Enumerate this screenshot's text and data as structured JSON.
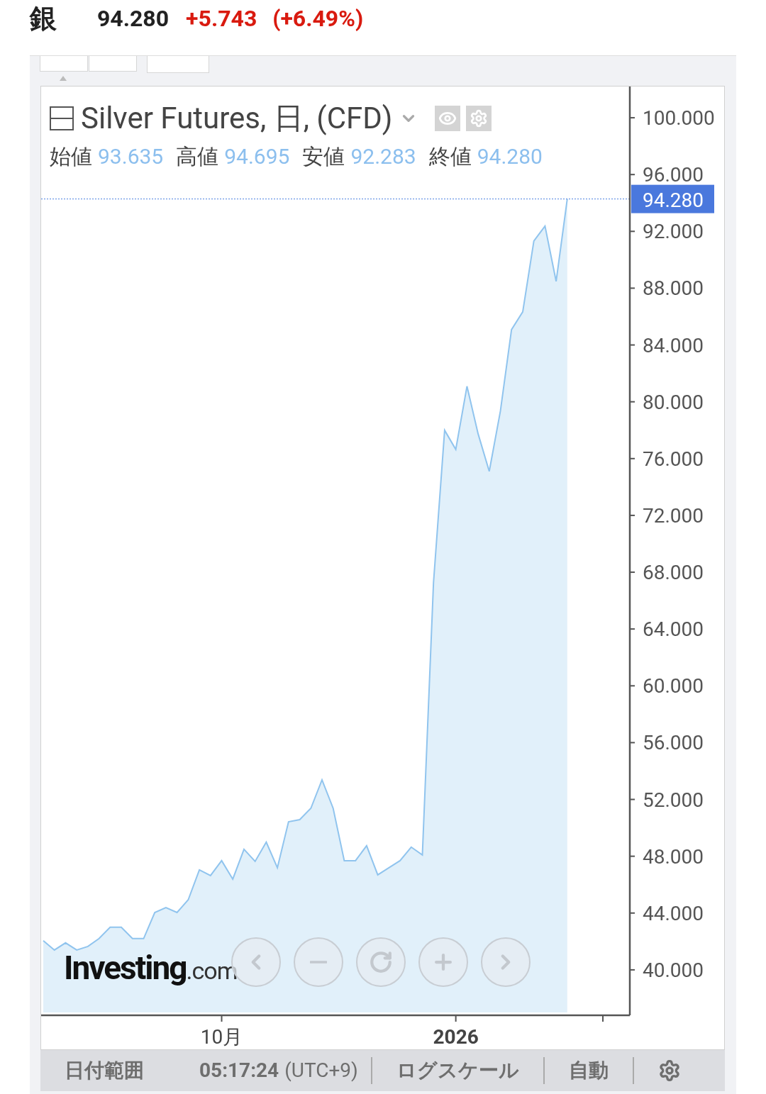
{
  "header": {
    "name": "銀",
    "price": "94.280",
    "change": "+5.743",
    "change_percent": "(+6.49%)"
  },
  "chart": {
    "title": "Silver Futures, 日, (CFD)",
    "ohlc": [
      {
        "label": "始値",
        "value": "93.635"
      },
      {
        "label": "高値",
        "value": "94.695"
      },
      {
        "label": "安値",
        "value": "92.283"
      },
      {
        "label": "終値",
        "value": "94.280"
      }
    ],
    "last_price": "94.280",
    "logo": {
      "name": "Investing",
      "suffix": ".com"
    },
    "chart_data": {
      "type": "area",
      "ylim": [
        36.8,
        102.2
      ],
      "ref_lines": [
        {
          "axis": "y",
          "value": 94.28,
          "color": "#4a7fe0"
        }
      ],
      "categories": [
        null,
        null,
        null,
        null,
        null,
        null,
        null,
        null,
        null,
        null,
        null,
        null,
        null,
        null,
        null,
        null,
        "10月",
        null,
        null,
        null,
        null,
        null,
        null,
        null,
        null,
        null,
        null,
        null,
        null,
        null,
        null,
        null,
        null,
        null,
        null,
        null,
        null,
        "2026",
        null,
        null,
        null,
        null,
        null,
        null,
        null,
        null,
        null,
        null
      ],
      "series": [
        {
          "color": "#90c4ee",
          "values": [
            42.05,
            41.4,
            41.9,
            41.4,
            41.65,
            42.2,
            43.0,
            43.0,
            42.2,
            42.2,
            44.04,
            44.39,
            44.04,
            44.94,
            47.04,
            46.64,
            47.69,
            46.39,
            48.49,
            47.64,
            48.99,
            47.19,
            50.43,
            50.58,
            51.38,
            53.38,
            51.38,
            47.69,
            47.69,
            48.74,
            46.69,
            47.19,
            47.69,
            48.64,
            48.09,
            67.26,
            77.99,
            76.65,
            81.09,
            77.74,
            75.1,
            79.34,
            85.08,
            86.33,
            91.32,
            92.37,
            88.48,
            94.28
          ]
        }
      ],
      "yticks": [
        {
          "value": 40,
          "label": "40.000"
        },
        {
          "value": 44,
          "label": "44.000"
        },
        {
          "value": 48,
          "label": "48.000"
        },
        {
          "value": 52,
          "label": "52.000"
        },
        {
          "value": 56,
          "label": "56.000"
        },
        {
          "value": 60,
          "label": "60.000"
        },
        {
          "value": 64,
          "label": "64.000"
        },
        {
          "value": 68,
          "label": "68.000"
        },
        {
          "value": 72,
          "label": "72.000"
        },
        {
          "value": 76,
          "label": "76.000"
        },
        {
          "value": 80,
          "label": "80.000"
        },
        {
          "value": 84,
          "label": "84.000"
        },
        {
          "value": 88,
          "label": "88.000"
        },
        {
          "value": 92,
          "label": "92.000"
        },
        {
          "value": 96,
          "label": "96.000"
        },
        {
          "value": 100,
          "label": "100.000"
        }
      ]
    }
  },
  "bottom_bar": {
    "date_range": "日付範囲",
    "time": "05:17:24",
    "timezone": "(UTC+9)",
    "log_scale": "ログスケール",
    "auto": "自動"
  }
}
